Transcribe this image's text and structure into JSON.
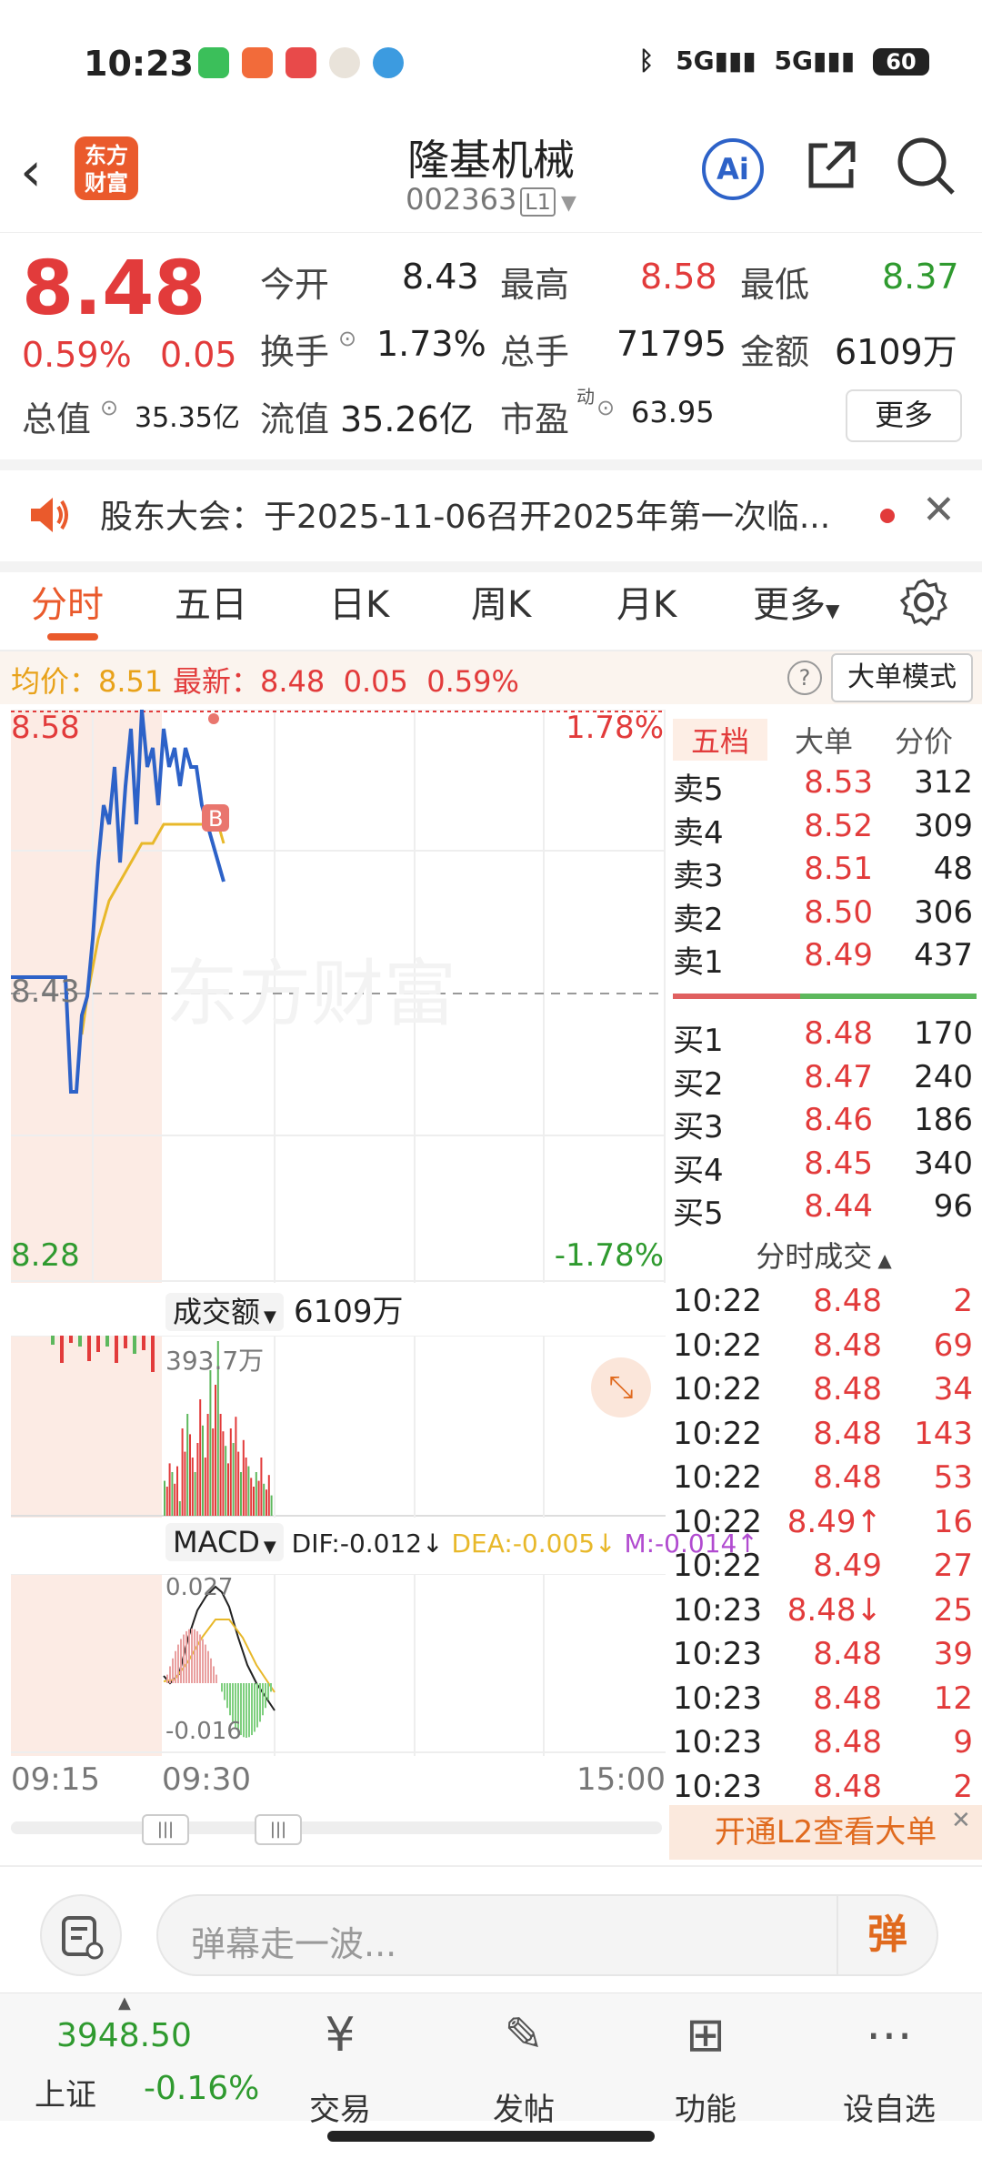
{
  "status": {
    "time": "10:23",
    "net1": "5G",
    "net2": "5G",
    "battery": "60"
  },
  "header": {
    "logo_line1": "东方",
    "logo_line2": "财富",
    "title": "隆基机械",
    "code": "002363",
    "level": "L1",
    "ai_label": "Ai"
  },
  "quote": {
    "price": "8.48",
    "change_pct": "0.59%",
    "change": "0.05",
    "open_label": "今开",
    "open": "8.43",
    "high_label": "最高",
    "high": "8.58",
    "low_label": "最低",
    "low": "8.37",
    "turnover_label": "换手",
    "turnover": "1.73%",
    "volume_label": "总手",
    "volume": "71795",
    "amount_label": "金额",
    "amount": "6109万",
    "mktcap_label": "总值",
    "mktcap": "35.35亿",
    "float_label": "流值",
    "float_cap": "35.26亿",
    "pe_label": "市盈",
    "pe_sup": "动",
    "pe": "63.95",
    "more_label": "更多"
  },
  "notice": {
    "text": "股东大会：于2025-11-06召开2025年第一次临..."
  },
  "tabs": [
    "分时",
    "五日",
    "日K",
    "周K",
    "月K",
    "更多"
  ],
  "avg_bar": {
    "avg_label": "均价：",
    "avg": "8.51",
    "latest_label": "最新：",
    "latest": "8.48",
    "chg": "0.05",
    "pct": "0.59%",
    "big_mode": "大单模式"
  },
  "chart_data": {
    "type": "line",
    "y_top": "8.58",
    "y_mid": "8.43",
    "y_bottom": "8.28",
    "pct_top": "1.78%",
    "pct_bottom": "-1.78%",
    "ylim": [
      8.28,
      8.58
    ],
    "x_labels": [
      "09:15",
      "09:30",
      "15:00"
    ],
    "watermark": "东方财富",
    "marker": "B",
    "series": [],
    "price_x": [
      0,
      2,
      4,
      6,
      8,
      10,
      11,
      12,
      13,
      14,
      15,
      16,
      17,
      18,
      19,
      20,
      21,
      22,
      23,
      24,
      25,
      26,
      27,
      28,
      29,
      30,
      31,
      32,
      33,
      34,
      35,
      36,
      37,
      38,
      39
    ],
    "price": [
      8.44,
      8.44,
      8.44,
      8.44,
      8.44,
      8.44,
      8.38,
      8.38,
      8.42,
      8.43,
      8.46,
      8.5,
      8.53,
      8.52,
      8.55,
      8.5,
      8.54,
      8.57,
      8.52,
      8.58,
      8.55,
      8.56,
      8.53,
      8.57,
      8.55,
      8.56,
      8.54,
      8.56,
      8.55,
      8.55,
      8.53,
      8.52,
      8.51,
      8.5,
      8.49
    ],
    "avg_x": [
      13,
      14,
      16,
      18,
      20,
      22,
      24,
      26,
      28,
      30,
      32,
      34,
      36,
      38,
      39
    ],
    "avg": [
      8.41,
      8.43,
      8.46,
      8.48,
      8.49,
      8.5,
      8.51,
      8.51,
      8.52,
      8.52,
      8.52,
      8.52,
      8.52,
      8.52,
      8.51
    ]
  },
  "volume": {
    "selector": "成交额",
    "total": "6109万",
    "max_label": "393.7万"
  },
  "macd": {
    "selector": "MACD",
    "dif": "DIF:-0.012↓",
    "dea": "DEA:-0.005↓",
    "m": "M:-0.014↑",
    "top": "0.027",
    "bottom": "-0.016"
  },
  "orderbook": {
    "tabs": [
      "五档",
      "大单",
      "分价"
    ],
    "asks": [
      {
        "label": "卖5",
        "price": "8.53",
        "vol": "312"
      },
      {
        "label": "卖4",
        "price": "8.52",
        "vol": "309"
      },
      {
        "label": "卖3",
        "price": "8.51",
        "vol": "48"
      },
      {
        "label": "卖2",
        "price": "8.50",
        "vol": "306"
      },
      {
        "label": "卖1",
        "price": "8.49",
        "vol": "437"
      }
    ],
    "bids": [
      {
        "label": "买1",
        "price": "8.48",
        "vol": "170"
      },
      {
        "label": "买2",
        "price": "8.47",
        "vol": "240"
      },
      {
        "label": "买3",
        "price": "8.46",
        "vol": "186"
      },
      {
        "label": "买4",
        "price": "8.45",
        "vol": "340"
      },
      {
        "label": "买5",
        "price": "8.44",
        "vol": "96"
      }
    ],
    "trades_title": "分时成交",
    "trades": [
      {
        "t": "10:22",
        "p": "8.48",
        "v": "2"
      },
      {
        "t": "10:22",
        "p": "8.48",
        "v": "69"
      },
      {
        "t": "10:22",
        "p": "8.48",
        "v": "34"
      },
      {
        "t": "10:22",
        "p": "8.48",
        "v": "143"
      },
      {
        "t": "10:22",
        "p": "8.48",
        "v": "53"
      },
      {
        "t": "10:22",
        "p": "8.49↑",
        "v": "16"
      },
      {
        "t": "10:22",
        "p": "8.49",
        "v": "27"
      },
      {
        "t": "10:23",
        "p": "8.48↓",
        "v": "25"
      },
      {
        "t": "10:23",
        "p": "8.48",
        "v": "39"
      },
      {
        "t": "10:23",
        "p": "8.48",
        "v": "12"
      },
      {
        "t": "10:23",
        "p": "8.48",
        "v": "9"
      },
      {
        "t": "10:23",
        "p": "8.48",
        "v": "2"
      }
    ],
    "l2_label": "开通L2查看大单"
  },
  "danmu": {
    "placeholder": "弹幕走一波...",
    "send": "弹"
  },
  "tabbar": {
    "index_value": "3948.50",
    "index_name": "上证",
    "index_pct": "-0.16%",
    "items": [
      "交易",
      "发帖",
      "功能",
      "设自选"
    ]
  }
}
